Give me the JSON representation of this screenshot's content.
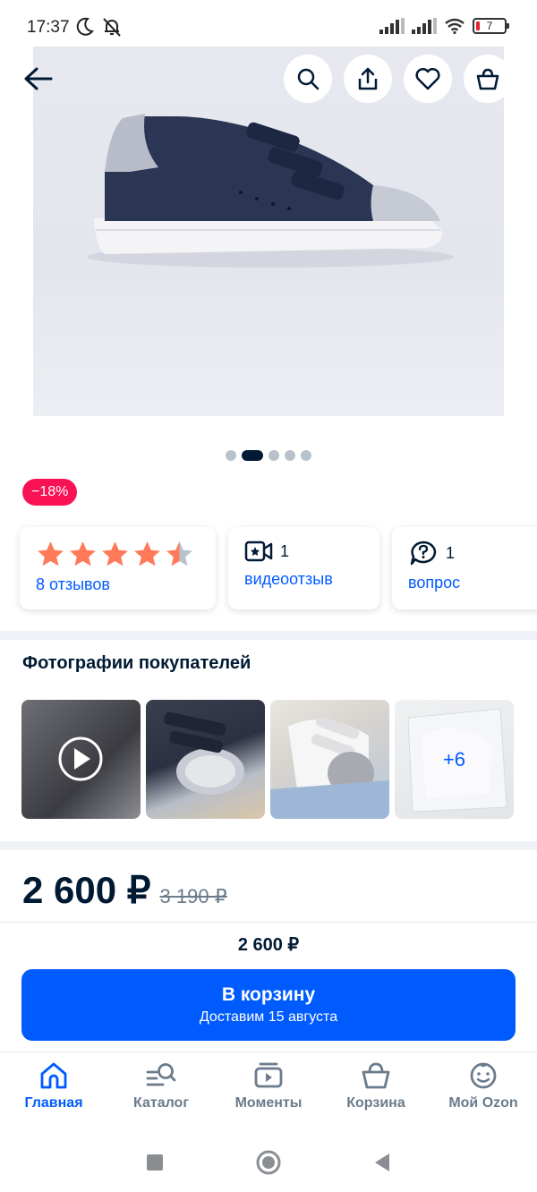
{
  "status_bar": {
    "time": "17:37",
    "battery": "7"
  },
  "pager": {
    "total": 5,
    "active_index": 1
  },
  "discount_badge": "−18%",
  "stats": {
    "rating": {
      "stars_value": 4.5,
      "stars_max": 5,
      "label": "8 отзывов"
    },
    "video": {
      "count": "1",
      "label": "видеоотзыв"
    },
    "questions": {
      "count": "1",
      "label": "вопрос"
    }
  },
  "customer_photos": {
    "title": "Фотографии покупателей",
    "more_label": "+6"
  },
  "price": {
    "current": "2 600 ₽",
    "old": "3 190 ₽"
  },
  "bottom_panel": {
    "price": "2 600 ₽",
    "cart_button_title": "В корзину",
    "cart_button_subtitle": "Доставим 15 августа"
  },
  "bottom_nav": [
    {
      "label": "Главная",
      "icon": "home-icon",
      "active": true
    },
    {
      "label": "Каталог",
      "icon": "catalog-search-icon",
      "active": false
    },
    {
      "label": "Моменты",
      "icon": "moments-icon",
      "active": false
    },
    {
      "label": "Корзина",
      "icon": "cart-icon",
      "active": false
    },
    {
      "label": "Мой Ozon",
      "icon": "profile-icon",
      "active": false
    }
  ],
  "colors": {
    "accent": "#005bff",
    "discount": "#f91155",
    "text": "#001a34",
    "star": "#ff7a59"
  }
}
